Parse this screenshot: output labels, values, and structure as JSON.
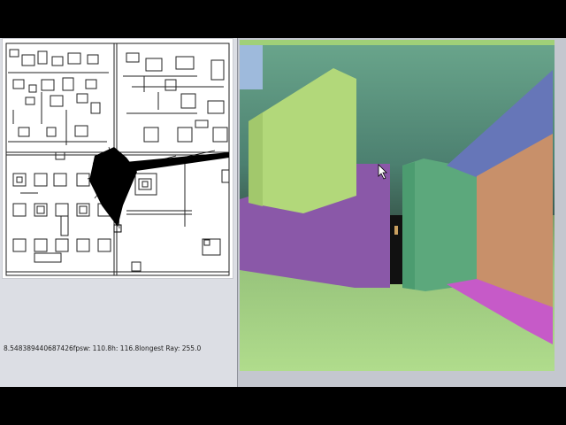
{
  "status": {
    "text": "8.548389440687426fpsw: 110.8h: 116.8longest Ray: 255.0"
  },
  "colors": {
    "ceiling": "#5c9c82",
    "floor": "#a8d48a",
    "wall_lime": "#b2d87a",
    "wall_purple": "#8a58a8",
    "wall_green": "#5ca87c",
    "wall_orange": "#c8906a",
    "wall_blue": "#6676b8",
    "wall_magenta": "#c65ac8",
    "sky_patch": "#9ebadc",
    "map_wall": "#222222",
    "ray_fan": "#000000"
  },
  "icons": {
    "cursor": "mouse-pointer-icon"
  }
}
